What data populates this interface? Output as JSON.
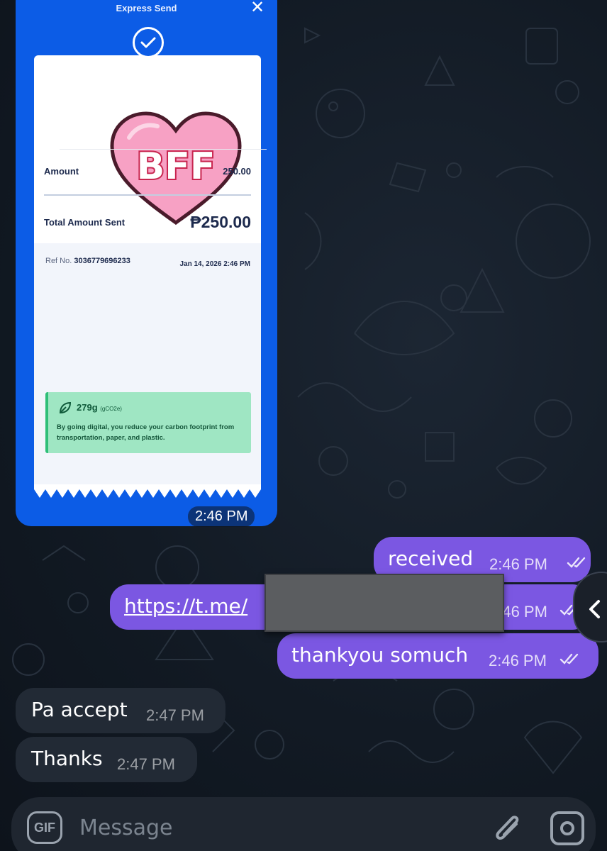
{
  "receipt": {
    "header_title": "Express Send",
    "close_icon": "close-icon",
    "sticker_text": "BFF",
    "amount_label": "Amount",
    "amount_value": "250.00",
    "total_label": "Total Amount Sent",
    "total_value": "₱250.00",
    "ref_label": "Ref No.",
    "ref_number": "3036779696233",
    "date": "Jan 14, 2026 2:46 PM",
    "eco_value": "279g",
    "eco_unit": "(gCO2e)",
    "eco_text": "By going digital, you reduce your carbon footprint from transportation, paper, and plastic.",
    "time": "2:46 PM"
  },
  "messages": [
    {
      "direction": "out",
      "text": "received",
      "time": "2:46 PM"
    },
    {
      "direction": "out",
      "text": "https://t.me/",
      "time": "2:46 PM"
    },
    {
      "direction": "out",
      "text": "thankyou somuch",
      "time": "2:46 PM"
    },
    {
      "direction": "in",
      "text": "Pa accept",
      "time": "2:47 PM"
    },
    {
      "direction": "in",
      "text": "Thanks",
      "time": "2:47 PM"
    }
  ],
  "composer": {
    "gif_label": "GIF",
    "placeholder": "Message",
    "attach_icon": "paperclip-icon",
    "camera_icon": "camera-icon"
  },
  "colors": {
    "outgoing_bubble": "#7b57e2",
    "incoming_bubble": "#222a35",
    "receipt_blue": "#0c5ce6",
    "eco_green": "#9fe6c3"
  }
}
